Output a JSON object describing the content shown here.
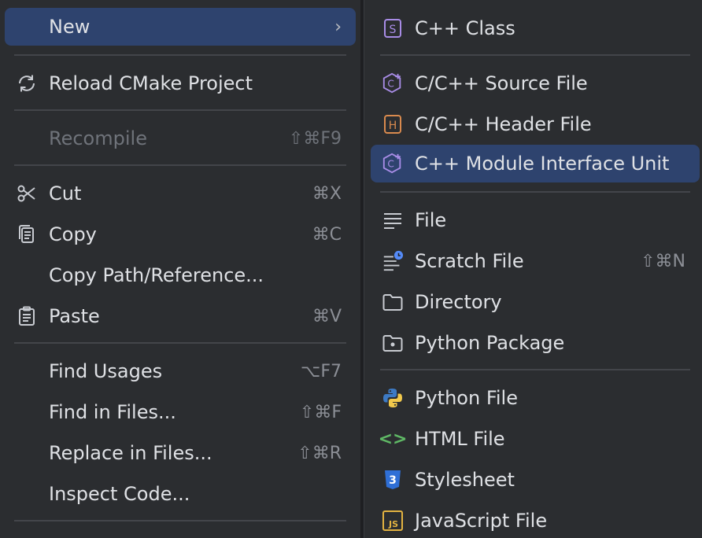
{
  "left_menu": {
    "new": {
      "label": "New",
      "submenu": "›"
    },
    "reload": {
      "label": "Reload CMake Project",
      "icon": "reload-icon"
    },
    "recompile": {
      "label": "Recompile",
      "shortcut": "⇧⌘F9"
    },
    "cut": {
      "label": "Cut",
      "shortcut": "⌘X",
      "icon": "scissors-icon"
    },
    "copy": {
      "label": "Copy",
      "shortcut": "⌘C",
      "icon": "copy-icon"
    },
    "copy_path": {
      "label": "Copy Path/Reference..."
    },
    "paste": {
      "label": "Paste",
      "shortcut": "⌘V",
      "icon": "clipboard-icon"
    },
    "find_usages": {
      "label": "Find Usages",
      "shortcut": "⌥F7"
    },
    "find_in_files": {
      "label": "Find in Files...",
      "shortcut": "⇧⌘F"
    },
    "replace_in_files": {
      "label": "Replace in Files...",
      "shortcut": "⇧⌘R"
    },
    "inspect_code": {
      "label": "Inspect Code..."
    }
  },
  "right_menu": {
    "cpp_class": {
      "label": "C++ Class",
      "icon_text": "S"
    },
    "source_file": {
      "label": "C/C++ Source File",
      "icon_text": "C"
    },
    "header_file": {
      "label": "C/C++ Header File",
      "icon_text": "H"
    },
    "module_unit": {
      "label": "C++ Module Interface Unit",
      "icon_text": "C"
    },
    "file": {
      "label": "File"
    },
    "scratch_file": {
      "label": "Scratch File",
      "shortcut": "⇧⌘N"
    },
    "directory": {
      "label": "Directory"
    },
    "python_package": {
      "label": "Python Package"
    },
    "python_file": {
      "label": "Python File"
    },
    "html_file": {
      "label": "HTML File",
      "icon_text": "<>"
    },
    "stylesheet": {
      "label": "Stylesheet",
      "icon_text": "3"
    },
    "javascript_file": {
      "label": "JavaScript File",
      "icon_text": "JS"
    }
  },
  "colors": {
    "menu_bg": "#2b2d30",
    "selection": "#2e436e",
    "text": "#dfe1e5",
    "shortcut": "#8c8f96",
    "disabled": "#6f737a",
    "separator": "#43454a",
    "cpp_purple": "#a88ce6",
    "header_orange": "#d98a4e",
    "html_green": "#5fb865",
    "css_blue": "#2f6fd6",
    "js_yellow": "#e3b341"
  }
}
